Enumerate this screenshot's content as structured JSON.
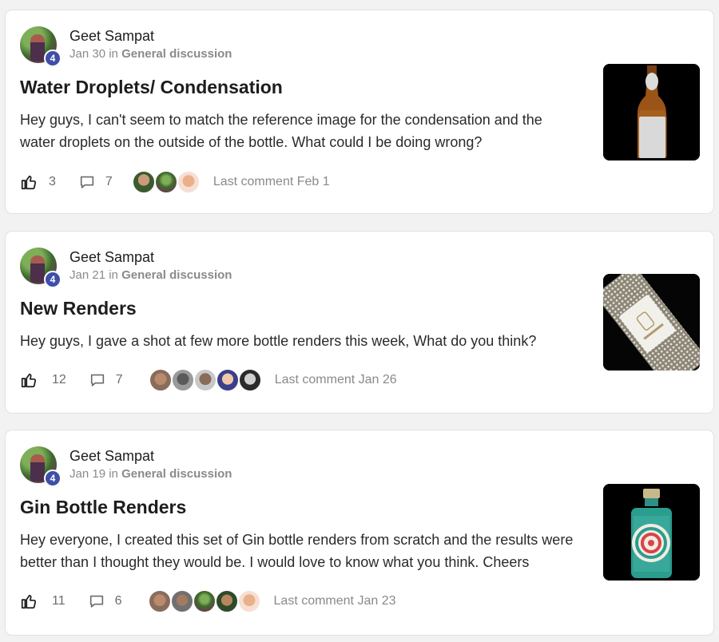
{
  "posts": [
    {
      "author": "Geet Sampat",
      "badge": "4",
      "date": "Jan 30",
      "in_word": "in",
      "category": "General discussion",
      "title": "Water Droplets/ Condensation",
      "body": "Hey guys, I can't seem to match the reference image for the condensation and the water droplets on the outside of the bottle. What could I be doing wrong?",
      "likes": "3",
      "comments": "7",
      "participant_icons": [
        "avatar",
        "avatar",
        "avatar"
      ],
      "last_comment": "Last comment Feb 1",
      "thumbnail_icon": "amber-bottle-image"
    },
    {
      "author": "Geet Sampat",
      "badge": "4",
      "date": "Jan 21",
      "in_word": "in",
      "category": "General discussion",
      "title": "New Renders",
      "body": "Hey guys, I gave a shot at few more bottle renders this week, What do you think?",
      "likes": "12",
      "comments": "7",
      "participant_icons": [
        "avatar",
        "avatar",
        "avatar",
        "avatar",
        "avatar"
      ],
      "last_comment": "Last comment Jan 26",
      "thumbnail_icon": "textured-gin-bottle-image"
    },
    {
      "author": "Geet Sampat",
      "badge": "4",
      "date": "Jan 19",
      "in_word": "in",
      "category": "General discussion",
      "title": "Gin Bottle Renders",
      "body": "Hey everyone, I created this set of Gin bottle renders from scratch and the results were better than I thought they would be. I would love to know what you think. Cheers",
      "likes": "11",
      "comments": "6",
      "participant_icons": [
        "avatar",
        "avatar",
        "avatar",
        "avatar",
        "avatar"
      ],
      "last_comment": "Last comment Jan 23",
      "thumbnail_icon": "teal-gin-bottle-image"
    }
  ],
  "colors": {
    "badge": "#3f4fa8",
    "meta_text": "#8a8a8a",
    "title_text": "#1d1d1d",
    "card_bg": "#ffffff",
    "page_bg": "#f2f2f2"
  }
}
